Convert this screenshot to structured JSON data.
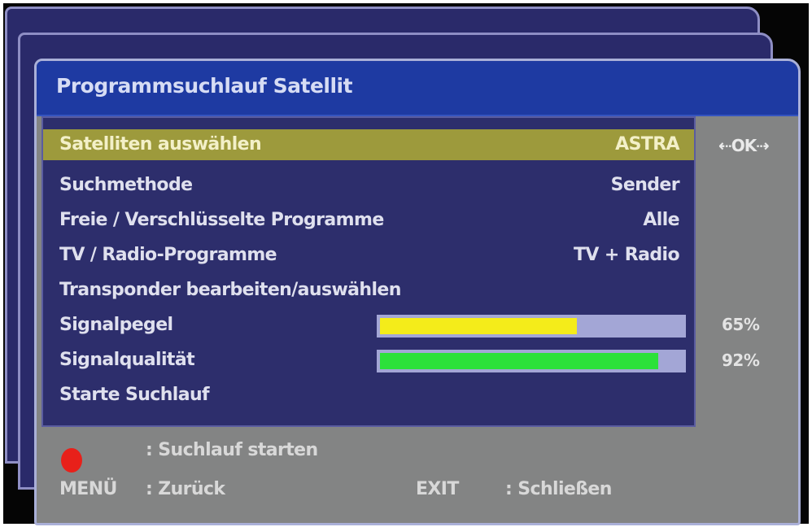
{
  "dialog": {
    "title": "Programmsuchlauf Satellit"
  },
  "menu": {
    "items": [
      {
        "label": "Satelliten auswählen",
        "value": "ASTRA"
      },
      {
        "label": "Suchmethode",
        "value": "Sender"
      },
      {
        "label": "Freie / Verschlüsselte Programme",
        "value": "Alle"
      },
      {
        "label": "TV / Radio-Programme",
        "value": "TV + Radio"
      },
      {
        "label": "Transponder bearbeiten/auswählen",
        "value": ""
      },
      {
        "label": "Signalpegel",
        "value": ""
      },
      {
        "label": "Signalqualität",
        "value": ""
      },
      {
        "label": "Starte Suchlauf",
        "value": ""
      }
    ],
    "selected_index": 0
  },
  "side": {
    "ok_hint": "⇠OK⇢"
  },
  "signal": {
    "level_percent": 65,
    "level_label": "65%",
    "quality_percent": 92,
    "quality_label": "92%",
    "level_color": "#f4ec1a",
    "quality_color": "#2ce13a"
  },
  "footer": {
    "red_action": ": Suchlauf starten",
    "menu_key": "MENÜ",
    "menu_action": ": Zurück",
    "exit_key": "EXIT",
    "exit_action": ": Schließen"
  },
  "colors": {
    "title_bar": "#1e3aa2",
    "panel": "#2d2e6c",
    "selected_row": "#9d9a3c",
    "dialog_gray": "#838484",
    "red_button": "#e8201a"
  },
  "icons": {
    "red_button": "red-circle-icon"
  }
}
